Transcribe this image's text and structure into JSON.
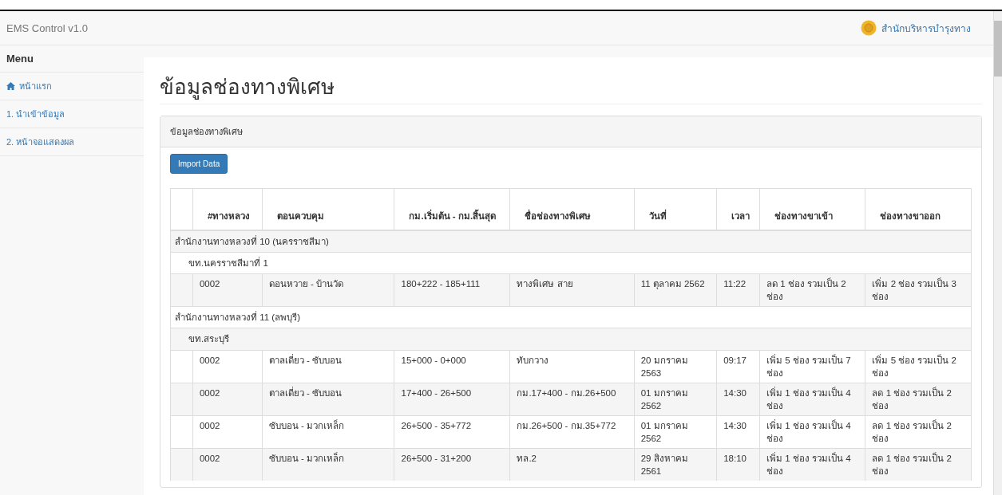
{
  "navbar": {
    "brand": "EMS Control v1.0",
    "organization": "สำนักบริหารบำรุงทาง"
  },
  "sidebar": {
    "heading": "Menu",
    "items": [
      {
        "label": "หน้าแรก",
        "kind": "home"
      },
      {
        "label": "1. นำเข้าข้อมูล",
        "kind": "link"
      },
      {
        "label": "2. หน้าจอแสดงผล",
        "kind": "link"
      }
    ]
  },
  "page_title": "ข้อมูลช่องทางพิเศษ",
  "panel": {
    "heading": "ข้อมูลช่องทางพิเศษ",
    "import_button": "Import Data",
    "table": {
      "columns": [
        "",
        "#ทางหลวง",
        "ตอนควบคุม",
        "กม.เริ่มต้น - กม.สิ้นสุด",
        "ชื่อช่องทางพิเศษ",
        "วันที่",
        "เวลา",
        "ช่องทางขาเข้า",
        "ช่องทางขาออก"
      ],
      "groups": [
        {
          "name": "สำนักงานทางหลวงที่ 10 (นครราชสีมา)",
          "subgroups": [
            {
              "name": "ขท.นครราชสีมาที่ 1",
              "rows": [
                [
                  "0002",
                  "ดอนหวาย - บ้านวัด",
                  "180+222 - 185+111",
                  "ทางพิเศษ สาย",
                  "11 ตุลาคม 2562",
                  "11:22",
                  "ลด 1 ช่อง รวมเป็น 2 ช่อง",
                  "เพิ่ม 2 ช่อง รวมเป็น 3 ช่อง"
                ]
              ]
            }
          ]
        },
        {
          "name": "สำนักงานทางหลวงที่ 11 (ลพบุรี)",
          "subgroups": [
            {
              "name": "ขท.สระบุรี",
              "rows": [
                [
                  "0002",
                  "ตาลเดี่ยว - ซับบอน",
                  "15+000 - 0+000",
                  "ทับกวาง",
                  "20 มกราคม 2563",
                  "09:17",
                  "เพิ่ม 5 ช่อง รวมเป็น 7 ช่อง",
                  "เพิ่ม 5 ช่อง รวมเป็น 2 ช่อง"
                ],
                [
                  "0002",
                  "ตาลเดี่ยว - ซับบอน",
                  "17+400 - 26+500",
                  "กม.17+400 - กม.26+500",
                  "01 มกราคม 2562",
                  "14:30",
                  "เพิ่ม 1 ช่อง รวมเป็น 4 ช่อง",
                  "ลด 1 ช่อง รวมเป็น 2 ช่อง"
                ],
                [
                  "0002",
                  "ซับบอน - มวกเหล็ก",
                  "26+500 - 35+772",
                  "กม.26+500 - กม.35+772",
                  "01 มกราคม 2562",
                  "14:30",
                  "เพิ่ม 1 ช่อง รวมเป็น 4 ช่อง",
                  "ลด 1 ช่อง รวมเป็น 2 ช่อง"
                ],
                [
                  "0002",
                  "ซับบอน - มวกเหล็ก",
                  "26+500 - 31+200",
                  "ทล.2",
                  "29 สิงหาคม 2561",
                  "18:10",
                  "เพิ่ม 1 ช่อง รวมเป็น 4 ช่อง",
                  "ลด 1 ช่อง รวมเป็น 2 ช่อง"
                ]
              ]
            }
          ]
        }
      ]
    }
  }
}
